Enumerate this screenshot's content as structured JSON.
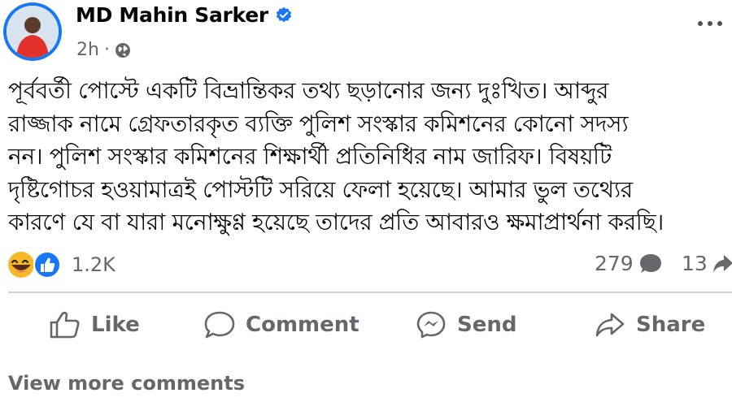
{
  "post": {
    "author": "MD Mahin Sarker",
    "time": "2h",
    "text_lines": [
      "পূর্ববর্তী পোস্টে একটি বিভ্রান্তিকর তথ্য ছড়ানোর জন্য দুঃখিত। আব্দুর",
      "রাজ্জাক নামে গ্রেফতারকৃত ব্যক্তি পুলিশ সংস্কার কমিশনের কোনো সদস্য",
      "নন। পুলিশ সংস্কার কমিশনের শিক্ষার্থী প্রতিনিধির নাম জারিফ। বিষয়টি",
      "দৃষ্টিগোচর হওয়ামাত্রই পোস্টটি সরিয়ে ফেলা হয়েছে। আমার ভুল তথ্যের",
      "কারণে যে বা যারা মনোক্ষুণ্ণ হয়েছে তাদের প্রতি আবারও ক্ষমাপ্রার্থনা করছি।"
    ]
  },
  "stats": {
    "reactions": "1.2K",
    "comments": "279",
    "shares": "13"
  },
  "actions": {
    "like": "Like",
    "comment": "Comment",
    "send": "Send",
    "share": "Share"
  },
  "footer": {
    "view_more": "View more comments"
  },
  "colors": {
    "verified": "#1877f2",
    "secondary_text": "#65676b",
    "like_blue": "#1877f2",
    "haha_yellow": "#f7b928"
  },
  "icons": {
    "verified": "verified-badge-icon",
    "privacy": "globe-icon",
    "reaction_1": "haha-reaction-icon",
    "reaction_2": "like-reaction-icon",
    "comment_count": "comment-bubble-icon",
    "share_count": "share-arrow-icon"
  }
}
